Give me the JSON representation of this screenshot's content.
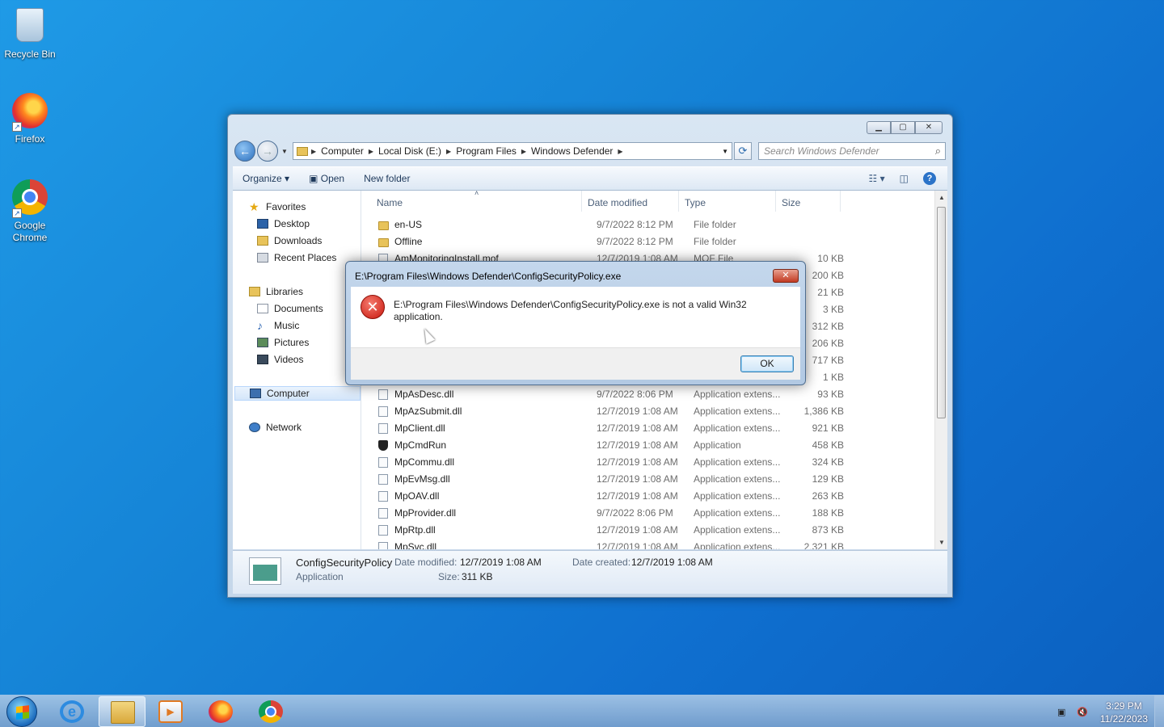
{
  "desktop": {
    "icons": [
      {
        "label": "Recycle Bin",
        "icon": "recycle-bin-icon"
      },
      {
        "label": "Firefox",
        "icon": "firefox-icon"
      },
      {
        "label": "Google Chrome",
        "icon": "chrome-icon"
      }
    ]
  },
  "explorer": {
    "address": {
      "crumbs": [
        "Computer",
        "Local Disk (E:)",
        "Program Files",
        "Windows Defender"
      ]
    },
    "search_placeholder": "Search Windows Defender",
    "toolbar": {
      "organize": "Organize",
      "open": "Open",
      "new_folder": "New folder"
    },
    "nav": {
      "favorites": "Favorites",
      "desktop": "Desktop",
      "downloads": "Downloads",
      "recent_places": "Recent Places",
      "libraries": "Libraries",
      "documents": "Documents",
      "music": "Music",
      "pictures": "Pictures",
      "videos": "Videos",
      "computer": "Computer",
      "network": "Network"
    },
    "columns": {
      "name": "Name",
      "date": "Date modified",
      "type": "Type",
      "size": "Size"
    },
    "files": [
      {
        "name": "en-US",
        "date": "9/7/2022 8:12 PM",
        "type": "File folder",
        "size": "",
        "kind": "folder"
      },
      {
        "name": "Offline",
        "date": "9/7/2022 8:12 PM",
        "type": "File folder",
        "size": "",
        "kind": "folder"
      },
      {
        "name": "AmMonitoringInstall.mof",
        "date": "12/7/2019 1:08 AM",
        "type": "MOF File",
        "size": "10 KB",
        "kind": "file"
      },
      {
        "name": "",
        "date": "",
        "type": "",
        "size": "200 KB",
        "kind": "none"
      },
      {
        "name": "",
        "date": "",
        "type": "",
        "size": "21 KB",
        "kind": "none"
      },
      {
        "name": "",
        "date": "",
        "type": "",
        "size": "3 KB",
        "kind": "none"
      },
      {
        "name": "",
        "date": "",
        "type": "",
        "size": "312 KB",
        "kind": "none"
      },
      {
        "name": "",
        "date": "",
        "type": "",
        "size": "206 KB",
        "kind": "none"
      },
      {
        "name": "",
        "date": "",
        "type": "",
        "size": "717 KB",
        "kind": "none"
      },
      {
        "name": "",
        "date": "",
        "type": "",
        "size": "1 KB",
        "kind": "none"
      },
      {
        "name": "MpAsDesc.dll",
        "date": "9/7/2022 8:06 PM",
        "type": "Application extens...",
        "size": "93 KB",
        "kind": "dll"
      },
      {
        "name": "MpAzSubmit.dll",
        "date": "12/7/2019 1:08 AM",
        "type": "Application extens...",
        "size": "1,386 KB",
        "kind": "dll"
      },
      {
        "name": "MpClient.dll",
        "date": "12/7/2019 1:08 AM",
        "type": "Application extens...",
        "size": "921 KB",
        "kind": "dll"
      },
      {
        "name": "MpCmdRun",
        "date": "12/7/2019 1:08 AM",
        "type": "Application",
        "size": "458 KB",
        "kind": "app"
      },
      {
        "name": "MpCommu.dll",
        "date": "12/7/2019 1:08 AM",
        "type": "Application extens...",
        "size": "324 KB",
        "kind": "dll"
      },
      {
        "name": "MpEvMsg.dll",
        "date": "12/7/2019 1:08 AM",
        "type": "Application extens...",
        "size": "129 KB",
        "kind": "dll"
      },
      {
        "name": "MpOAV.dll",
        "date": "12/7/2019 1:08 AM",
        "type": "Application extens...",
        "size": "263 KB",
        "kind": "dll"
      },
      {
        "name": "MpProvider.dll",
        "date": "9/7/2022 8:06 PM",
        "type": "Application extens...",
        "size": "188 KB",
        "kind": "dll"
      },
      {
        "name": "MpRtp.dll",
        "date": "12/7/2019 1:08 AM",
        "type": "Application extens...",
        "size": "873 KB",
        "kind": "dll"
      },
      {
        "name": "MpSvc.dll",
        "date": "12/7/2019 1:08 AM",
        "type": "Application extens...",
        "size": "2,321 KB",
        "kind": "dll"
      }
    ],
    "details": {
      "name": "ConfigSecurityPolicy",
      "kind": "Application",
      "date_modified_label": "Date modified:",
      "date_modified": "12/7/2019 1:08 AM",
      "date_created_label": "Date created:",
      "date_created": "12/7/2019 1:08 AM",
      "size_label": "Size:",
      "size": "311 KB"
    }
  },
  "dialog": {
    "title": "E:\\Program Files\\Windows Defender\\ConfigSecurityPolicy.exe",
    "message": "E:\\Program Files\\Windows Defender\\ConfigSecurityPolicy.exe is not a valid Win32 application.",
    "ok_label": "OK"
  },
  "taskbar": {
    "time": "3:29 PM",
    "date": "11/22/2023"
  }
}
